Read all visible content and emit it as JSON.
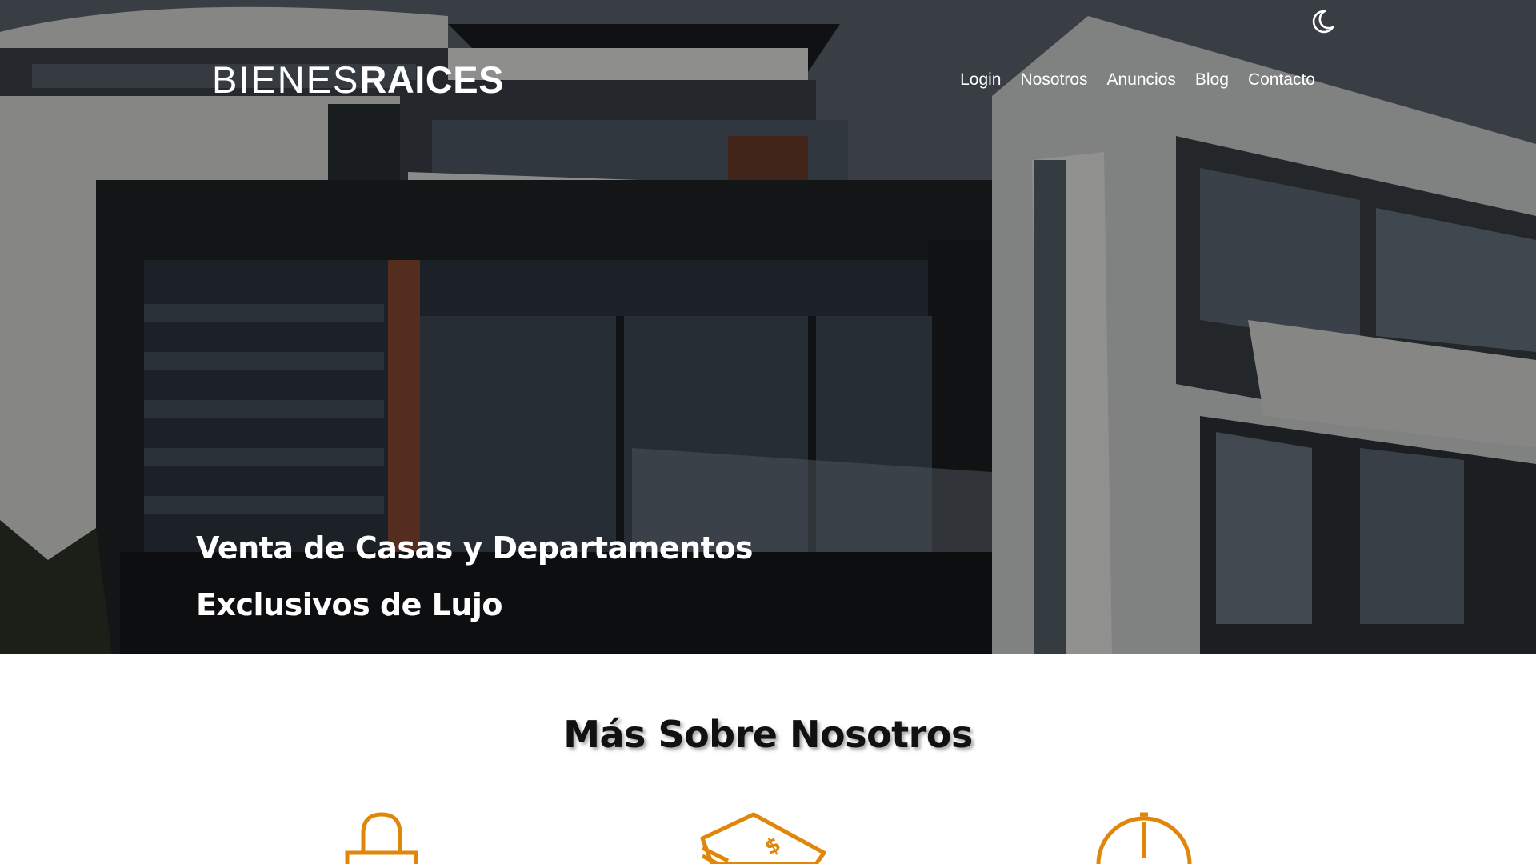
{
  "header": {
    "logo_light": "BIENES",
    "logo_bold": "RAICES",
    "dark_mode_icon": "moon-icon",
    "nav": [
      {
        "label": "Login"
      },
      {
        "label": "Nosotros"
      },
      {
        "label": "Anuncios"
      },
      {
        "label": "Blog"
      },
      {
        "label": "Contacto"
      }
    ]
  },
  "hero": {
    "title_line1": "Venta de Casas y Departamentos",
    "title_line2": "Exclusivos de Lujo"
  },
  "about": {
    "heading": "Más Sobre Nosotros",
    "icons": [
      "padlock-icon",
      "money-icon",
      "clock-icon"
    ]
  },
  "colors": {
    "accent": "#E08709",
    "text_dark": "#111111",
    "overlay": "rgba(0,0,0,0.38)"
  }
}
